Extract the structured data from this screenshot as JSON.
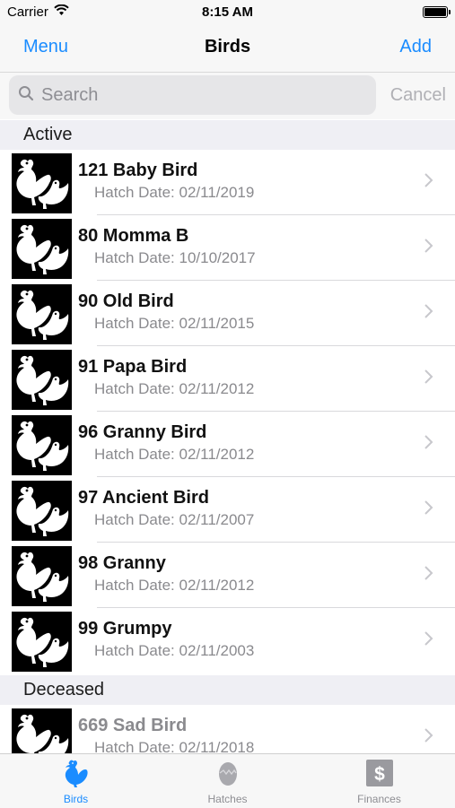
{
  "status": {
    "carrier": "Carrier",
    "time": "8:15 AM"
  },
  "nav": {
    "left": "Menu",
    "title": "Birds",
    "right": "Add"
  },
  "search": {
    "placeholder": "Search",
    "cancel": "Cancel"
  },
  "sections": {
    "active": {
      "title": "Active",
      "rows": [
        {
          "name": "121 Baby Bird",
          "sub": "Hatch Date: 02/11/2019"
        },
        {
          "name": "80 Momma B",
          "sub": "Hatch Date: 10/10/2017"
        },
        {
          "name": "90 Old Bird",
          "sub": "Hatch Date: 02/11/2015"
        },
        {
          "name": "91 Papa Bird",
          "sub": "Hatch Date: 02/11/2012"
        },
        {
          "name": "96 Granny Bird",
          "sub": "Hatch Date: 02/11/2012"
        },
        {
          "name": "97 Ancient Bird",
          "sub": "Hatch Date: 02/11/2007"
        },
        {
          "name": "98 Granny",
          "sub": "Hatch Date: 02/11/2012"
        },
        {
          "name": "99 Grumpy",
          "sub": "Hatch Date: 02/11/2003"
        }
      ]
    },
    "deceased": {
      "title": "Deceased",
      "rows": [
        {
          "name": "669 Sad Bird",
          "sub": "Hatch Date: 02/11/2018"
        }
      ]
    }
  },
  "tabs": [
    {
      "label": "Birds",
      "icon": "rooster-icon",
      "active": true
    },
    {
      "label": "Hatches",
      "icon": "egg-icon",
      "active": false
    },
    {
      "label": "Finances",
      "icon": "dollar-icon",
      "active": false
    }
  ],
  "colors": {
    "accent": "#1a8cff",
    "section_bg": "#efeff4",
    "bar_bg": "#f7f7f7"
  }
}
